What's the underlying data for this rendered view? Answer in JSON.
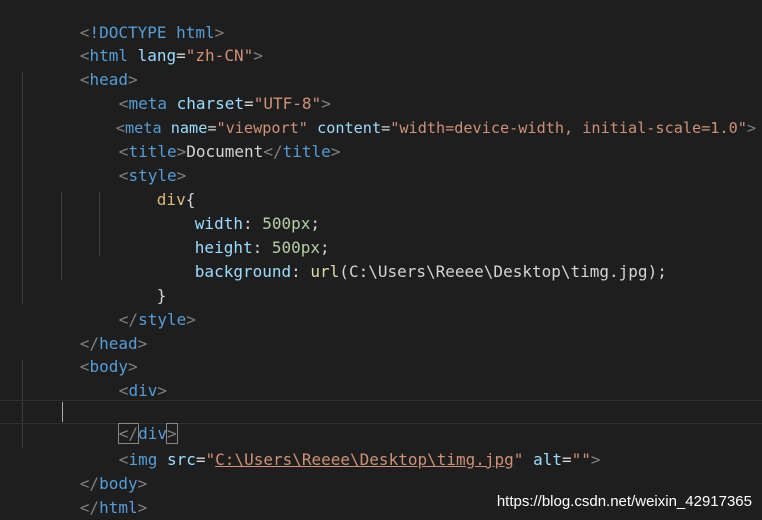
{
  "editor": {
    "language": "html",
    "current_line": 18,
    "lines": [
      [
        "<!DOCTYPE html>"
      ],
      [
        "<html lang=\"zh-CN\">"
      ],
      [
        "<head>"
      ],
      [
        "<meta charset=\"UTF-8\">"
      ],
      [
        "<meta name=\"viewport\" content=\"width=device-width, initial-scale=1.0\">"
      ],
      [
        "<title>Document</title>"
      ],
      [
        "<style>"
      ],
      [
        "div{"
      ],
      [
        "width: 500px;"
      ],
      [
        "height: 500px;"
      ],
      [
        "background: url(C:\\Users\\Reeee\\Desktop\\timg.jpg);"
      ],
      [
        "}"
      ],
      [
        "</style>"
      ],
      [
        "</head>"
      ],
      [
        "<body>"
      ],
      [
        "<div>"
      ],
      [
        ""
      ],
      [
        "</div>"
      ],
      [
        "<img src=\"C:\\Users\\Reeee\\Desktop\\timg.jpg\" alt=\"\">"
      ],
      [
        "</body>"
      ],
      [
        "</html>"
      ]
    ]
  },
  "tokens": {
    "l1": {
      "lt": "<",
      "bang": "!DOCTYPE",
      "html": "html",
      "gt": ">"
    },
    "l2": {
      "lt": "<",
      "tag": "html",
      "attr": "lang",
      "eq": "=",
      "val": "\"zh-CN\"",
      "gt": ">"
    },
    "l3": {
      "lt": "<",
      "tag": "head",
      "gt": ">"
    },
    "l4": {
      "lt": "<",
      "tag": "meta",
      "attr": "charset",
      "eq": "=",
      "val": "\"UTF-8\"",
      "gt": ">"
    },
    "l5": {
      "lt": "<",
      "tag": "meta",
      "attr1": "name",
      "eq1": "=",
      "val1": "\"viewport\"",
      "attr2": "content",
      "eq2": "=",
      "val2": "\"width=device-width, initial-scale=1.0\"",
      "gt": ">"
    },
    "l6": {
      "lt1": "<",
      "tag1": "title",
      "gt1": ">",
      "text": "Document",
      "lt2": "</",
      "tag2": "title",
      "gt2": ">"
    },
    "l7": {
      "lt": "<",
      "tag": "style",
      "gt": ">"
    },
    "l8": {
      "sel": "div",
      "brace": "{"
    },
    "l9": {
      "prop": "width",
      "colon": ": ",
      "num": "500px",
      "semi": ";"
    },
    "l10": {
      "prop": "height",
      "colon": ": ",
      "num": "500px",
      "semi": ";"
    },
    "l11": {
      "prop": "background",
      "colon": ": ",
      "fn": "url",
      "paren1": "(",
      "path": "C:\\Users\\Reeee\\Desktop\\timg.jpg",
      "paren2": ")",
      "semi": ";"
    },
    "l12": {
      "brace": "}"
    },
    "l13": {
      "lt": "</",
      "tag": "style",
      "gt": ">"
    },
    "l14": {
      "lt": "</",
      "tag": "head",
      "gt": ">"
    },
    "l15": {
      "lt": "<",
      "tag": "body",
      "gt": ">"
    },
    "l16": {
      "lt": "<",
      "tag": "div",
      "gt": ">"
    },
    "l18": {
      "lt": "</",
      "tag": "div",
      "gt": ">"
    },
    "l19": {
      "lt": "<",
      "tag": "img",
      "attr1": "src",
      "eq1": "=",
      "q1": "\"",
      "link": "C:\\Users\\Reeee\\Desktop\\timg.jpg",
      "q2": "\"",
      "attr2": "alt",
      "eq2": "=",
      "val2": "\"\"",
      "gt": ">"
    },
    "l20": {
      "lt": "</",
      "tag": "body",
      "gt": ">"
    },
    "l21": {
      "lt": "</",
      "tag": "html",
      "gt": ">"
    }
  },
  "watermark": {
    "text": "https://blog.csdn.net/weixin_42917365"
  },
  "colors": {
    "background": "#1e1e1e",
    "tag": "#569cd6",
    "punctuation": "#808080",
    "attribute": "#9cdcfe",
    "string": "#ce9178",
    "selector": "#d7ba7d",
    "number": "#b5cea8",
    "function": "#dcdcaa",
    "text": "#d4d4d4"
  }
}
